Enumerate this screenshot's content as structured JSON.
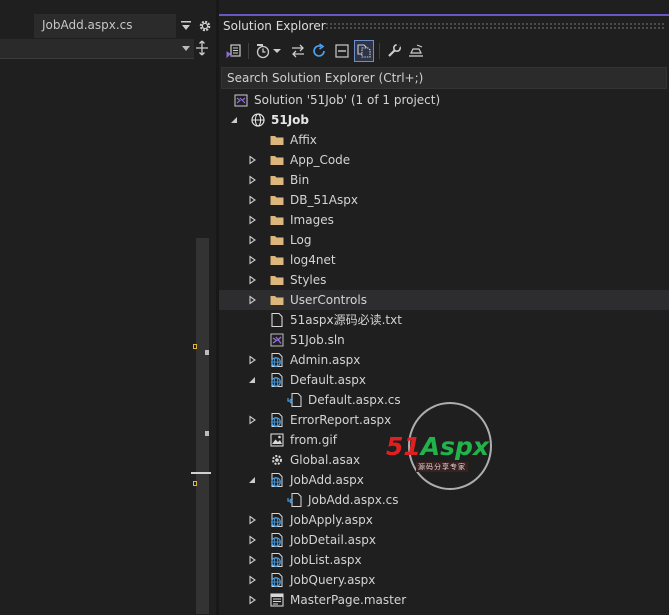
{
  "editor": {
    "tab_label": "JobAdd.aspx.cs",
    "overflow_icon": "tab-overflow-icon",
    "settings_icon": "gear-icon"
  },
  "solution_explorer": {
    "title": "Solution Explorer",
    "search_placeholder": "Search Solution Explorer (Ctrl+;)",
    "toolbar": [
      "vs-switch-views-icon",
      "history-icon",
      "dropdown-caret-icon",
      "sync-icon",
      "refresh-icon",
      "collapse-all-icon",
      "show-all-files-icon",
      "wrench-icon",
      "preview-icon"
    ],
    "tree": [
      {
        "label": "Solution '51Job' (1 of 1 project)",
        "icon": "solution-icon",
        "level": 0,
        "expander": "none"
      },
      {
        "label": "51Job",
        "icon": "web-project-icon",
        "level": 0,
        "expander": "expanded",
        "bold": true
      },
      {
        "label": "Affix",
        "icon": "folder-icon",
        "level": 1,
        "expander": "none"
      },
      {
        "label": "App_Code",
        "icon": "folder-icon",
        "level": 1,
        "expander": "collapsed"
      },
      {
        "label": "Bin",
        "icon": "folder-icon",
        "level": 1,
        "expander": "collapsed"
      },
      {
        "label": "DB_51Aspx",
        "icon": "folder-icon",
        "level": 1,
        "expander": "collapsed"
      },
      {
        "label": "Images",
        "icon": "folder-icon",
        "level": 1,
        "expander": "collapsed"
      },
      {
        "label": "Log",
        "icon": "folder-icon",
        "level": 1,
        "expander": "collapsed"
      },
      {
        "label": "log4net",
        "icon": "folder-icon",
        "level": 1,
        "expander": "collapsed"
      },
      {
        "label": "Styles",
        "icon": "folder-icon",
        "level": 1,
        "expander": "collapsed"
      },
      {
        "label": "UserControls",
        "icon": "folder-icon",
        "level": 1,
        "expander": "collapsed",
        "selected": true
      },
      {
        "label": "51aspx源码必读.txt",
        "icon": "text-file-icon",
        "level": 1,
        "expander": "none"
      },
      {
        "label": "51Job.sln",
        "icon": "vs-solution-file-icon",
        "level": 1,
        "expander": "none"
      },
      {
        "label": "Admin.aspx",
        "icon": "web-page-icon",
        "level": 1,
        "expander": "collapsed"
      },
      {
        "label": "Default.aspx",
        "icon": "web-page-icon",
        "level": 1,
        "expander": "expanded"
      },
      {
        "label": "Default.aspx.cs",
        "icon": "cs-code-file-icon",
        "level": 2,
        "expander": "none"
      },
      {
        "label": "ErrorReport.aspx",
        "icon": "web-page-icon",
        "level": 1,
        "expander": "collapsed"
      },
      {
        "label": "from.gif",
        "icon": "image-file-icon",
        "level": 1,
        "expander": "none"
      },
      {
        "label": "Global.asax",
        "icon": "global-asax-icon",
        "level": 1,
        "expander": "none"
      },
      {
        "label": "JobAdd.aspx",
        "icon": "web-page-icon",
        "level": 1,
        "expander": "expanded"
      },
      {
        "label": "JobAdd.aspx.cs",
        "icon": "cs-code-file-icon",
        "level": 2,
        "expander": "none"
      },
      {
        "label": "JobApply.aspx",
        "icon": "web-page-icon",
        "level": 1,
        "expander": "collapsed"
      },
      {
        "label": "JobDetail.aspx",
        "icon": "web-page-icon",
        "level": 1,
        "expander": "collapsed"
      },
      {
        "label": "JobList.aspx",
        "icon": "web-page-icon",
        "level": 1,
        "expander": "collapsed"
      },
      {
        "label": "JobQuery.aspx",
        "icon": "web-page-icon",
        "level": 1,
        "expander": "collapsed"
      },
      {
        "label": "MasterPage.master",
        "icon": "master-page-icon",
        "level": 1,
        "expander": "collapsed"
      }
    ]
  },
  "watermark": {
    "brand_number": "51",
    "brand_name": "Aspx",
    "slogan": "源码分享专家"
  },
  "colors": {
    "background": "#1f1f1f",
    "accent": "#6b56c5",
    "folder": "#dcb67a",
    "web_globe": "#4aa0e6",
    "watermark_red": "#e02020",
    "watermark_green": "#22b34a"
  }
}
